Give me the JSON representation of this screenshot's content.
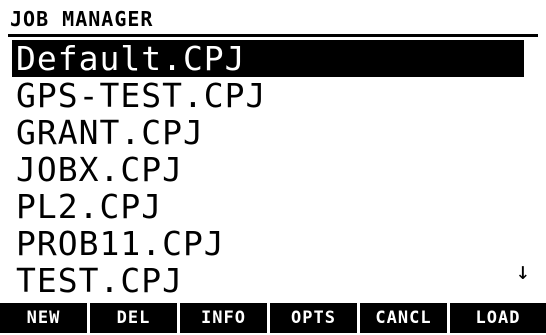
{
  "title": "JOB MANAGER",
  "files": [
    {
      "name": "Default.CPJ",
      "selected": true
    },
    {
      "name": "GPS-TEST.CPJ",
      "selected": false
    },
    {
      "name": "GRANT.CPJ",
      "selected": false
    },
    {
      "name": "JOBX.CPJ",
      "selected": false
    },
    {
      "name": "PL2.CPJ",
      "selected": false
    },
    {
      "name": "PROB11.CPJ",
      "selected": false
    },
    {
      "name": "TEST.CPJ",
      "selected": false
    }
  ],
  "scroll_indicator": "↓",
  "softkeys": [
    {
      "label": "NEW"
    },
    {
      "label": "DEL"
    },
    {
      "label": "INFO"
    },
    {
      "label": "OPTS"
    },
    {
      "label": "CANCL"
    },
    {
      "label": "LOAD"
    }
  ],
  "colors": {
    "background": "#ffffff",
    "foreground": "#000000",
    "selection": "#000000"
  }
}
